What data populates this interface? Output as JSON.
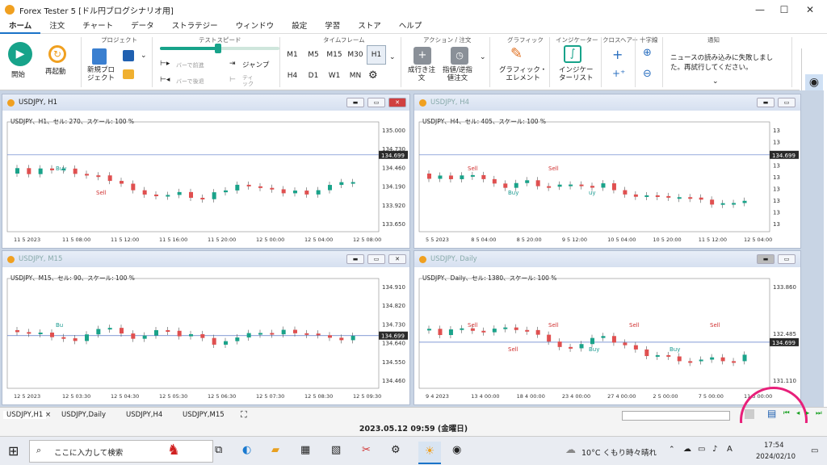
{
  "window": {
    "title": "Forex Tester 5 [ドル円ブログシナリオ用]",
    "minimize": "—",
    "maximize": "☐",
    "close": "✕"
  },
  "menu": [
    "ホーム",
    "注文",
    "チャート",
    "データ",
    "ストラテジー",
    "ウィンドウ",
    "設定",
    "学習",
    "ストア",
    "ヘルプ"
  ],
  "ribbon": {
    "groups": {
      "project": "プロジェクト",
      "speed": "テストスピード",
      "timeframe": "タイムフレーム",
      "action": "アクション / 注文",
      "graphic": "グラフィック",
      "indicator": "インジケーター",
      "crosshair": "クロスヘアー",
      "crossword": "十字線",
      "notice": "通知"
    },
    "start": "開始",
    "restart": "再起動",
    "new_project": "新規プロ\nジェクト",
    "bar_fwd": "バーで前進",
    "bar_back": "バーで後退",
    "jump": "ジャンプ",
    "detail": "ティ\nック",
    "timeframes": [
      "M1",
      "M5",
      "M15",
      "M30",
      "H1",
      "H4",
      "D1",
      "W1",
      "MN"
    ],
    "selected_tf": "H1",
    "market_order": "成行き注\n文",
    "limit_order": "指値/逆指\n値注文",
    "graphic_elem": "グラフィック・\nエレメント",
    "indicator_btn": "インジケー\nターリスト",
    "notice_text": "ニュースの読み込みに失敗しまし\nた。再試行してください。"
  },
  "panels": [
    {
      "title": "USDJPY, H1",
      "info": "USDJPY、H1、セル: 270、スケール: 100 %",
      "price": "134.699",
      "active": true
    },
    {
      "title": "USDJPY, H4",
      "info": "USDJPY、H4、セル: 405、スケール: 100 %",
      "price": "134.699",
      "active": false
    },
    {
      "title": "USDJPY, M15",
      "info": "USDJPY、M15、セル: 90、スケール: 100 %",
      "price": "134.699",
      "active": false
    },
    {
      "title": "USDJPY, Daily",
      "info": "USDJPY、Daily、セル: 1380、スケール: 100 %",
      "price": "134.699",
      "active": false
    }
  ],
  "chart_data": [
    {
      "type": "candlestick",
      "title": "USDJPY, H1",
      "ylim": [
        133.6,
        135.1
      ],
      "yticks": [
        "135.000",
        "134.730",
        "134.460",
        "134.190",
        "133.920",
        "133.650"
      ],
      "xticks": [
        "11 5 2023",
        "11 5 08:00",
        "11 5 12:00",
        "11 5 16:00",
        "11 5 20:00",
        "12 5 00:00",
        "12 5 04:00",
        "12 5 08:00"
      ],
      "annotations": [
        "Buy",
        "Sell"
      ]
    },
    {
      "type": "candlestick",
      "title": "USDJPY, H4",
      "yticks": [
        "13",
        "13",
        "13",
        "13",
        "13",
        "13",
        "13",
        "13",
        "13"
      ],
      "xticks": [
        "5 5 2023",
        "8 5 04:00",
        "8 5 20:00",
        "9 5 12:00",
        "10 5 04:00",
        "10 5 20:00",
        "11 5 12:00",
        "12 5 04:00"
      ],
      "annotations": [
        "Sell",
        "Buy",
        "Sell",
        "uy"
      ]
    },
    {
      "type": "candlestick",
      "title": "USDJPY, M15",
      "ylim": [
        134.43,
        134.93
      ],
      "yticks": [
        "134.910",
        "134.820",
        "134.730",
        "134.640",
        "134.550",
        "134.460"
      ],
      "xticks": [
        "12 5 2023",
        "12 5 03:30",
        "12 5 04:30",
        "12 5 05:30",
        "12 5 06:30",
        "12 5 07:30",
        "12 5 08:30",
        "12 5 09:30"
      ],
      "annotations": [
        "Bu"
      ]
    },
    {
      "type": "candlestick",
      "title": "USDJPY, Daily",
      "ylim": [
        130.9,
        136.0
      ],
      "yticks": [
        "133.860",
        "132.485",
        "131.110"
      ],
      "xticks": [
        "9 4 2023",
        "13 4 00:00",
        "18 4 00:00",
        "23 4 00:00",
        "27 4 00:00",
        "2 5 00:00",
        "7 5 00:00",
        "11 5 00:00"
      ],
      "annotations": [
        "Sell",
        "Sell",
        "Sell",
        "Buy",
        "Sell",
        "Buy",
        "Sell"
      ]
    }
  ],
  "tabs": [
    "USDJPY,H1",
    "USDJPY,Daily",
    "USDJPY,H4",
    "USDJPY,M15"
  ],
  "tab_close": "×",
  "datetime": "2023.05.12 09:59 (金曜日)",
  "taskbar": {
    "search": "ここに入力して検索",
    "weather": "10°C くもり時々晴れ",
    "time": "17:54",
    "date": "2024/02/10"
  }
}
